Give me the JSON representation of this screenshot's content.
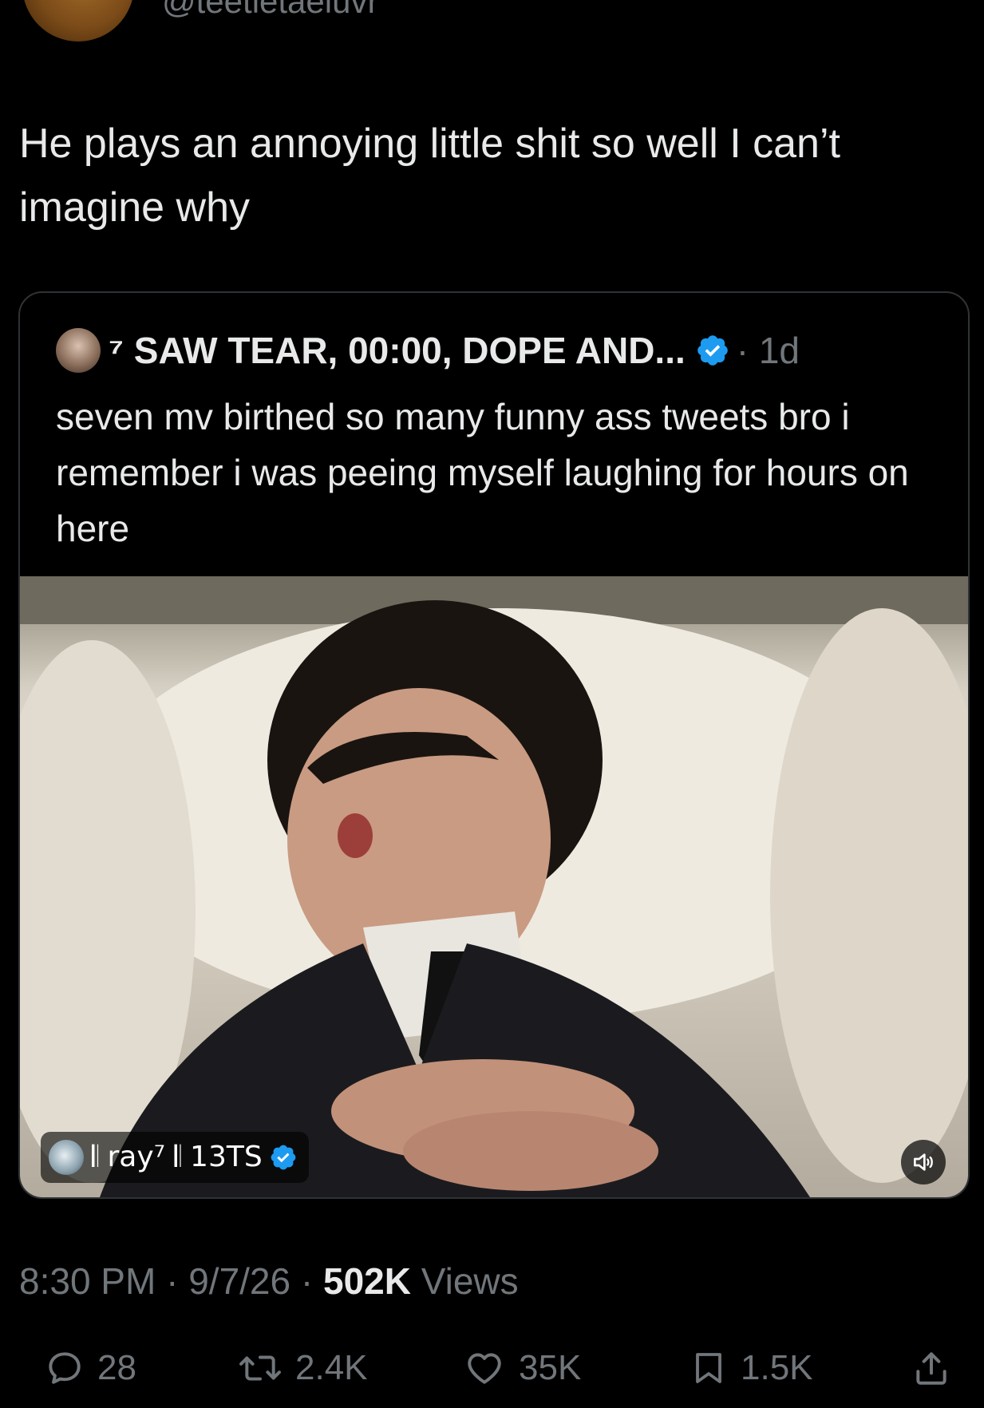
{
  "author": {
    "handle": "@teetletaeluvr"
  },
  "tweet": {
    "text": "He plays an annoying little shit so well I can’t imagine why"
  },
  "quote": {
    "name": "⁷ SAW TEAR, 00:00, DOPE AND...",
    "time": "· 1d",
    "text": "seven mv birthed so many funny ass tweets bro i remember i was peeing myself laughing for hours on here",
    "media": {
      "attribution_name": "𝄃 ray⁷ 𝄃 13TS",
      "attribution_verified": true,
      "sound_icon": "volume-icon"
    },
    "verified": true
  },
  "meta": {
    "time": "8:30 PM",
    "date": "9/7/26",
    "views_count": "502K",
    "views_label": "Views",
    "separator": " · "
  },
  "actions": {
    "reply_count": "28",
    "retweet_count": "2.4K",
    "like_count": "35K",
    "bookmark_count": "1.5K"
  },
  "colors": {
    "background": "#000000",
    "text": "#e7e9ea",
    "muted": "#71767b",
    "verified": "#1d9bf0",
    "border": "#2f3336"
  },
  "icons": {
    "reply": "reply-icon",
    "retweet": "retweet-icon",
    "like": "heart-icon",
    "bookmark": "bookmark-icon",
    "share": "share-icon",
    "verified": "verified-badge-icon"
  }
}
